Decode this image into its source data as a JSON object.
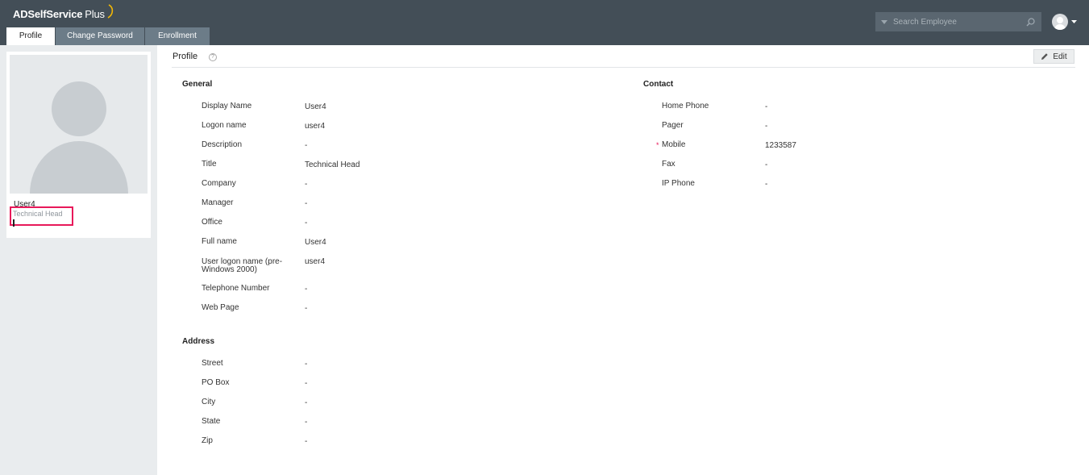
{
  "header": {
    "logo_main": "ADSelfService",
    "logo_plus": "Plus",
    "tabs": [
      "Profile",
      "Change Password",
      "Enrollment"
    ],
    "search_placeholder": "Search Employee"
  },
  "sidebar": {
    "name": "User4",
    "title": "Technical Head",
    "dash": "-"
  },
  "main": {
    "title": "Profile",
    "help": "?",
    "edit_label": "Edit",
    "general": {
      "heading": "General",
      "fields": [
        {
          "label": "Display Name",
          "value": "User4"
        },
        {
          "label": "Logon name",
          "value": "user4"
        },
        {
          "label": "Description",
          "value": "-"
        },
        {
          "label": "Title",
          "value": "Technical Head"
        },
        {
          "label": "Company",
          "value": "-"
        },
        {
          "label": "Manager",
          "value": "-"
        },
        {
          "label": "Office",
          "value": "-"
        },
        {
          "label": "Full name",
          "value": "User4"
        },
        {
          "label": "User logon name (pre-",
          "label2": "Windows 2000)",
          "value": "user4"
        },
        {
          "label": "Telephone Number",
          "value": "-"
        },
        {
          "label": "Web Page",
          "value": "-"
        }
      ]
    },
    "address": {
      "heading": "Address",
      "fields": [
        {
          "label": "Street",
          "value": "-"
        },
        {
          "label": "PO Box",
          "value": "-"
        },
        {
          "label": "City",
          "value": "-"
        },
        {
          "label": "State",
          "value": "-"
        },
        {
          "label": "Zip",
          "value": "-"
        }
      ]
    },
    "contact": {
      "heading": "Contact",
      "required_mark": "*",
      "fields": [
        {
          "label": "Home Phone",
          "value": "-"
        },
        {
          "label": "Pager",
          "value": "-"
        },
        {
          "label": "Mobile",
          "value": "1233587"
        },
        {
          "label": "Fax",
          "value": "-"
        },
        {
          "label": "IP Phone",
          "value": "-"
        }
      ]
    }
  },
  "colors": {
    "header_bg": "#434e57",
    "tab_bg": "#6c7c88",
    "highlight": "#e8195a",
    "required": "#e8195a"
  }
}
